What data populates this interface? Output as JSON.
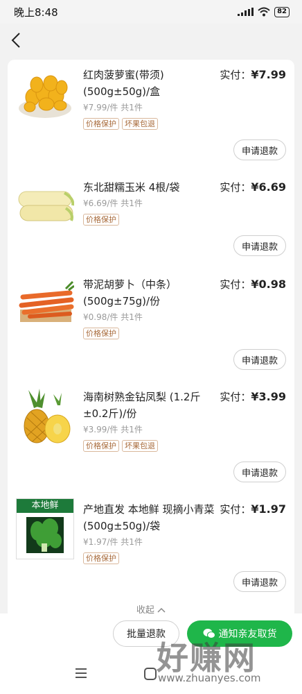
{
  "status_bar": {
    "time": "晚上8:48",
    "battery": "82"
  },
  "items": [
    {
      "title": "红肉菠萝蜜(带须) (500g±50g)/盒",
      "pay_label": "实付：",
      "pay_value": "¥7.99",
      "unit_info": "¥7.99/件  共1件",
      "tags": [
        "价格保护",
        "坏果包退"
      ],
      "refund_label": "申请退款",
      "image": "jackfruit-image"
    },
    {
      "title": "东北甜糯玉米 4根/袋",
      "pay_label": "实付：",
      "pay_value": "¥6.69",
      "unit_info": "¥6.69/件  共1件",
      "tags": [
        "价格保护"
      ],
      "refund_label": "申请退款",
      "image": "corn-image"
    },
    {
      "title": "带泥胡萝卜（中条） (500g±75g)/份",
      "pay_label": "实付：",
      "pay_value": "¥0.98",
      "unit_info": "¥0.98/件  共1件",
      "tags": [
        "价格保护"
      ],
      "refund_label": "申请退款",
      "image": "carrot-image"
    },
    {
      "title": "海南树熟金钻凤梨 (1.2斤±0.2斤)/份",
      "pay_label": "实付：",
      "pay_value": "¥3.99",
      "unit_info": "¥3.99/件  共1件",
      "tags": [
        "价格保护",
        "坏果包退"
      ],
      "refund_label": "申请退款",
      "image": "pineapple-image"
    },
    {
      "title": "产地直发 本地鲜 现摘小青菜 (500g±50g)/袋",
      "pay_label": "实付：",
      "pay_value": "¥1.97",
      "unit_info": "¥1.97/件  共1件",
      "tags": [
        "价格保护"
      ],
      "refund_label": "申请退款",
      "image": "bok-choy-image",
      "image_caption": "本地鲜"
    }
  ],
  "collapse_label": "收起",
  "actions": {
    "batch_refund": "批量退款",
    "notify_friend": "通知亲友取货"
  },
  "watermark": {
    "main": "好赚网",
    "sub": "www.zhuanyes.com"
  },
  "colors": {
    "accent_green": "#1fb64a",
    "tag_brown": "#a86a3a"
  }
}
